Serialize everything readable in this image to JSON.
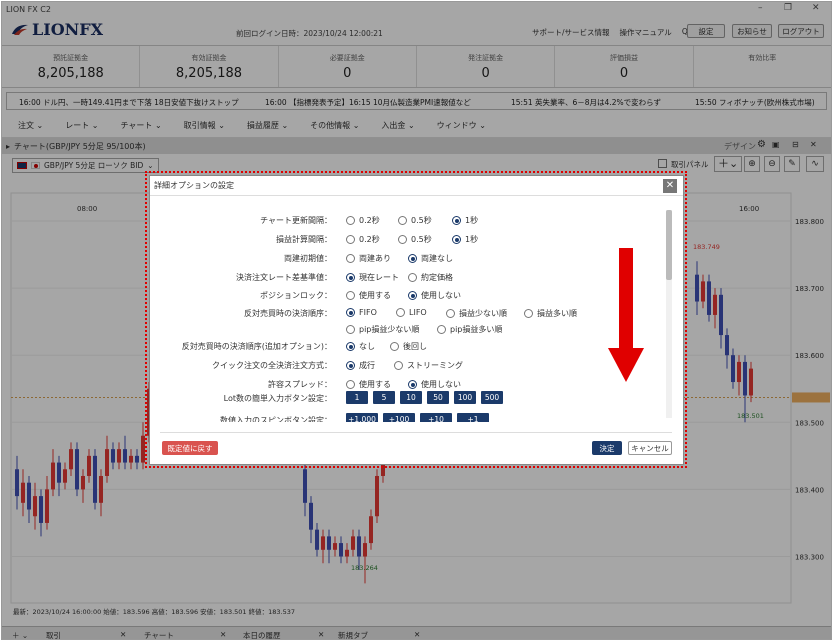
{
  "window": {
    "title": "LION FX C2"
  },
  "header": {
    "logo": "LIONFX",
    "last_login": "前回ログイン日時：2023/10/24 12:00:21",
    "links": [
      "サポート/サービス情報",
      "操作マニュアル",
      "Q&A"
    ],
    "buttons": [
      "設定",
      "お知らせ",
      "ログアウト"
    ]
  },
  "summary": [
    {
      "label": "預託証拠金",
      "value": "8,205,188"
    },
    {
      "label": "有効証拠金",
      "value": "8,205,188"
    },
    {
      "label": "必要証拠金",
      "value": "0"
    },
    {
      "label": "発注証拠金",
      "value": "0"
    },
    {
      "label": "評価損益",
      "value": "0"
    },
    {
      "label": "有効比率",
      "value": ""
    }
  ],
  "ticker": [
    "16:00 ドル円、一時149.41円まで下落 18日安値下抜けストップ",
    "16:00 【指標発表予定】16:15 10月仏製造業PMI速報値など",
    "15:51 英失業率、6－8月は4.2%で変わらず",
    "15:50 フィボナッチ(欧州株式市場)"
  ],
  "menu": [
    "注文",
    "レート",
    "チャート",
    "取引情報",
    "損益履歴",
    "その他情報",
    "入出金",
    "ウィンドウ"
  ],
  "chart": {
    "panel_title": "チャート(GBP/JPY 5分足 95/100本)",
    "design_label": "デザイン",
    "symbol_select": "GBP/JPY 5分足 ローソク BID",
    "trade_panel_label": "取引パネル",
    "time_labels": [
      "08:00",
      "16:00"
    ],
    "price_labels": [
      "183.800",
      "183.700",
      "183.600",
      "183.537",
      "183.500",
      "183.400",
      "183.300"
    ],
    "high_label": "183.749",
    "low_label": "183.264",
    "last_low_label": "183.501",
    "footer": "最新：2023/10/24 16:00:00 始値：183.596 高値：183.596 安値：183.501 終値：183.537"
  },
  "bottom_tabs": [
    "取引",
    "チャート",
    "本日の履歴",
    "新規タブ"
  ],
  "dialog": {
    "title": "詳細オプションの設定",
    "rows": [
      {
        "label": "チャート更新間隔：",
        "options": [
          "0.2秒",
          "0.5秒",
          "1秒"
        ],
        "selected": 2
      },
      {
        "label": "損益計算間隔：",
        "options": [
          "0.2秒",
          "0.5秒",
          "1秒"
        ],
        "selected": 2
      },
      {
        "label": "両建初期値：",
        "options": [
          "両建あり",
          "両建なし"
        ],
        "selected": 1
      },
      {
        "label": "決済注文レート差基準値：",
        "options": [
          "現在レート",
          "約定価格"
        ],
        "selected": 0
      },
      {
        "label": "ポジションロック：",
        "options": [
          "使用する",
          "使用しない"
        ],
        "selected": 1
      },
      {
        "label": "反対売買時の決済順序：",
        "options": [
          "FIFO",
          "LIFO",
          "損益少ない順",
          "損益多い順",
          "pip損益少ない順",
          "pip損益多い順"
        ],
        "selected": 0
      },
      {
        "label": "反対売買時の決済順序(追加オプション)：",
        "options": [
          "なし",
          "後回し"
        ],
        "selected": 0
      },
      {
        "label": "クイック注文の全決済注文方式：",
        "options": [
          "成行",
          "ストリーミング"
        ],
        "selected": 0
      },
      {
        "label": "許容スプレッド：",
        "options": [
          "使用する",
          "使用しない"
        ],
        "selected": 1
      }
    ],
    "lot_label": "Lot数の簡単入力ボタン設定：",
    "lot_buttons": [
      "1",
      "5",
      "10",
      "50",
      "100",
      "500"
    ],
    "spin_label": "数値入力のスピンボタン設定：",
    "spin_buttons": [
      "+1,000",
      "+100",
      "+10",
      "+1"
    ],
    "reset_label": "既定値に戻す",
    "ok_label": "決定",
    "cancel_label": "キャンセル"
  },
  "colors": {
    "navy": "#1b3a6a",
    "red": "#e00000",
    "up": "#e53935",
    "down": "#3f51b5"
  }
}
